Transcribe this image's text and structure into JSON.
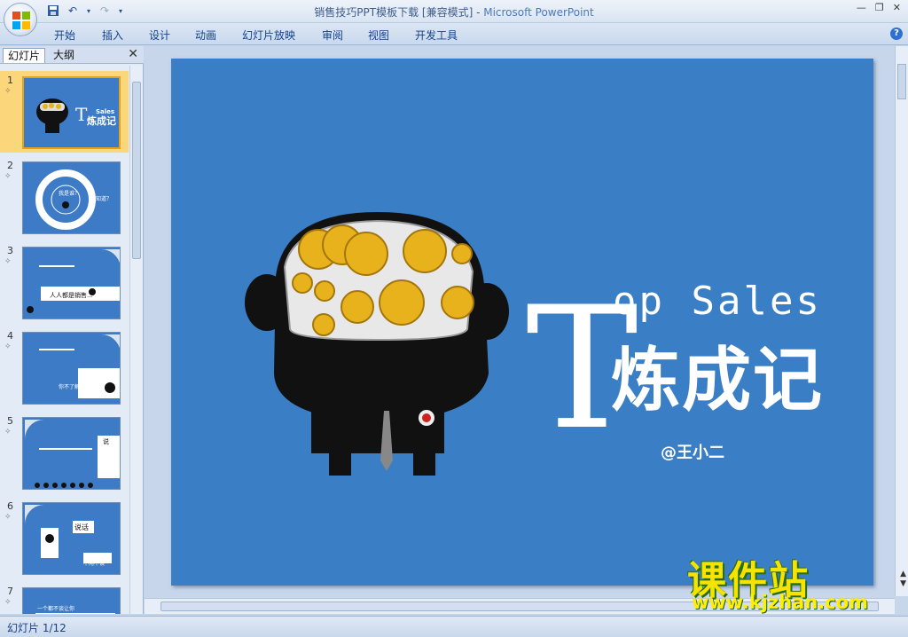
{
  "window": {
    "title": "销售技巧PPT模板下载 [兼容模式]",
    "app_name": "Microsoft PowerPoint",
    "separator": " - "
  },
  "ribbon": {
    "tabs": [
      "开始",
      "插入",
      "设计",
      "动画",
      "幻灯片放映",
      "审阅",
      "视图",
      "开发工具"
    ]
  },
  "left_panel": {
    "tabs": [
      "幻灯片",
      "大纲"
    ],
    "slide_numbers": [
      "1",
      "2",
      "3",
      "4",
      "5",
      "6",
      "7"
    ],
    "thumb_texts": {
      "s1_sales": "Sales",
      "s1_title": "炼成记",
      "s2_center": "我是谁？",
      "s2_side": "知道？",
      "s3_caption": "人人都是销售...",
      "s4_caption": "你不了解我们",
      "s5_label": "说",
      "s6_label": "说话",
      "s6_bottom": "不用不谈",
      "s7_caption": "一个都不谈让你"
    }
  },
  "slide": {
    "title_T": "T",
    "title_top": "op Sales",
    "title_cn": "炼成记",
    "author": "@王小二",
    "background": "#3a7ec6"
  },
  "status": {
    "text": "幻灯片 1/12"
  },
  "watermark": {
    "name": "课件站",
    "url": "www.kjzhan.com"
  }
}
